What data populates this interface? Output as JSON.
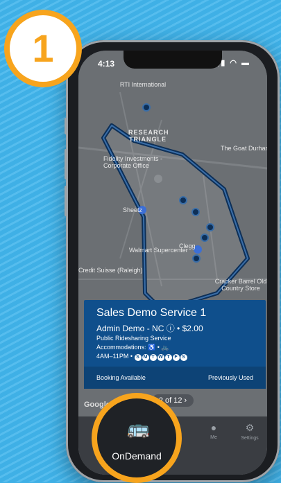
{
  "step_number": "1",
  "status_bar": {
    "time": "4:13",
    "right_icons": "signal wifi battery"
  },
  "map_labels": [
    "RTI International",
    "RESEARCH TRIANGLE",
    "The Goat Durham",
    "Fidelity Investments - Corporate Office",
    "Sheetz",
    "Walmart Supercenter",
    "Clegg",
    "Credit Suisse (Raleigh)",
    "Cracker Barrel Old Country Store"
  ],
  "card": {
    "title": "Sales Demo Service 1",
    "org": "Admin Demo - NC",
    "price": "$2.00",
    "type": "Public Ridesharing Service",
    "accommodations_label": "Accommodations:",
    "hours": "4AM–11PM",
    "days": [
      "S",
      "M",
      "T",
      "W",
      "T",
      "F",
      "S"
    ],
    "booking": "Booking Available",
    "used": "Previously Used"
  },
  "pager": "2 of 12",
  "google": "Google",
  "tabs": {
    "me": "Me",
    "settings": "Settings"
  },
  "ondemand_label": "OnDemand"
}
